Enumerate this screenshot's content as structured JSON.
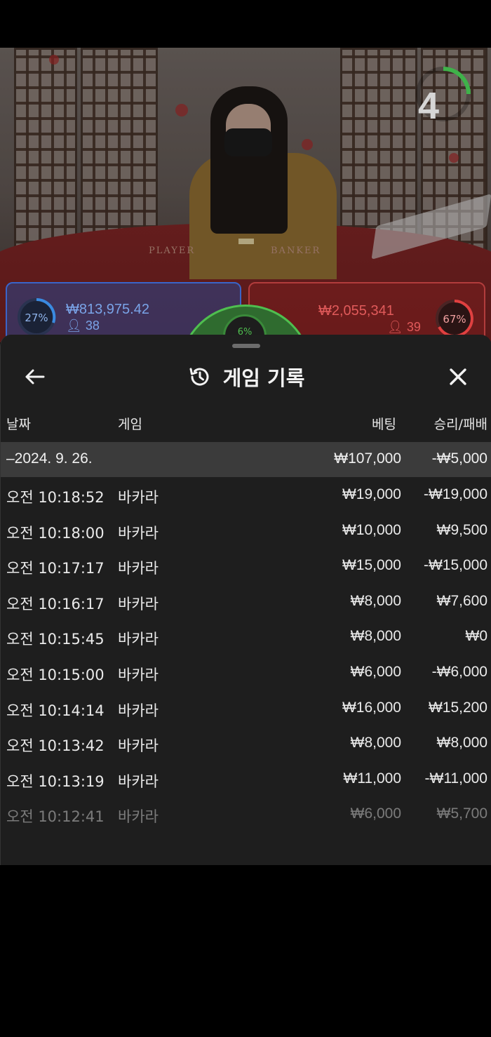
{
  "video": {
    "countdown": "4",
    "table_labels": {
      "player": "PLAYER",
      "banker": "BANKER"
    },
    "player_box": {
      "percent": "27%",
      "amount": "₩813,975.42",
      "count": "38",
      "color": "#3a64c8"
    },
    "banker_box": {
      "percent": "67%",
      "amount": "₩2,055,341",
      "count": "39",
      "color": "#b23c3c"
    },
    "center_percent": "6%"
  },
  "history": {
    "title": "게임 기록",
    "icons": {
      "back": "back-arrow-icon",
      "history": "history-clock-icon",
      "close": "close-icon"
    },
    "columns": {
      "date": "날짜",
      "game": "게임",
      "bet": "베팅",
      "win_loss": "승리/패배"
    },
    "date_group": {
      "label": "–2024. 9. 26.",
      "total_bet": "₩107,000",
      "total_result": "-₩5,000"
    },
    "rows": [
      {
        "time": "오전 10:18:52",
        "game": "바카라",
        "bet": "₩19,000",
        "result": "-₩19,000"
      },
      {
        "time": "오전 10:18:00",
        "game": "바카라",
        "bet": "₩10,000",
        "result": "₩9,500"
      },
      {
        "time": "오전 10:17:17",
        "game": "바카라",
        "bet": "₩15,000",
        "result": "-₩15,000"
      },
      {
        "time": "오전 10:16:17",
        "game": "바카라",
        "bet": "₩8,000",
        "result": "₩7,600"
      },
      {
        "time": "오전 10:15:45",
        "game": "바카라",
        "bet": "₩8,000",
        "result": "₩0"
      },
      {
        "time": "오전 10:15:00",
        "game": "바카라",
        "bet": "₩6,000",
        "result": "-₩6,000"
      },
      {
        "time": "오전 10:14:14",
        "game": "바카라",
        "bet": "₩16,000",
        "result": "₩15,200"
      },
      {
        "time": "오전 10:13:42",
        "game": "바카라",
        "bet": "₩8,000",
        "result": "₩8,000"
      },
      {
        "time": "오전 10:13:19",
        "game": "바카라",
        "bet": "₩11,000",
        "result": "-₩11,000"
      },
      {
        "time": "오전 10:12:41",
        "game": "바카라",
        "bet": "₩6,000",
        "result": "₩5,700"
      }
    ]
  }
}
